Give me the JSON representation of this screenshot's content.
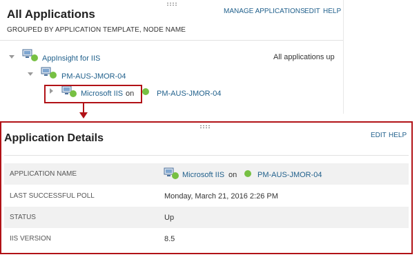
{
  "applications_panel": {
    "title": "All Applications",
    "subtitle": "GROUPED BY APPLICATION TEMPLATE, NODE NAME",
    "manage_label": "MANAGE APPLICATIONS",
    "edit_label": "EDIT",
    "help_label": "HELP",
    "tree": {
      "template_name": "AppInsight for IIS",
      "summary_status": "All applications up",
      "node_name": "PM-AUS-JMOR-04",
      "app_name": "Microsoft IIS",
      "on_text": "on",
      "app_node": "PM-AUS-JMOR-04"
    }
  },
  "details_panel": {
    "title": "Application Details",
    "edit_label": "EDIT",
    "help_label": "HELP",
    "rows": [
      {
        "label": "APPLICATION NAME",
        "app_name": "Microsoft IIS",
        "on_text": "on",
        "node": "PM-AUS-JMOR-04"
      },
      {
        "label": "LAST SUCCESSFUL POLL",
        "value": "Monday, March 21, 2016 2:26 PM"
      },
      {
        "label": "STATUS",
        "value": "Up"
      },
      {
        "label": "IIS VERSION",
        "value": "8.5"
      }
    ]
  },
  "colors": {
    "status_up": "#77c043",
    "link": "#1f5f8b",
    "callout": "#b11116"
  },
  "icons": [
    "application-icon",
    "status-up-dot-icon",
    "expand-triangle-icon",
    "drag-handle-icon"
  ]
}
